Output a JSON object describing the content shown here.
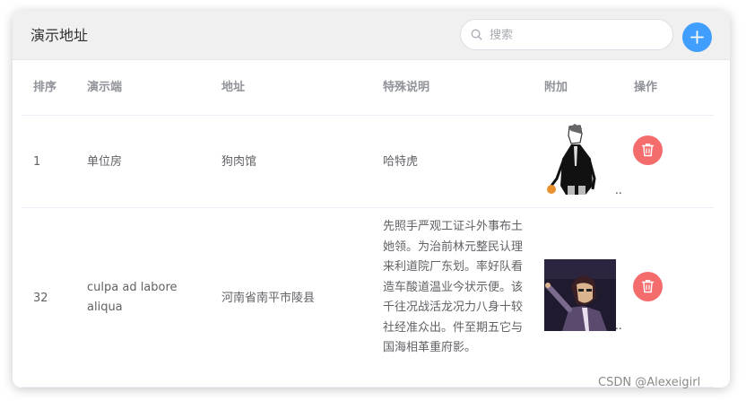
{
  "card": {
    "title": "演示地址",
    "search": {
      "placeholder": "搜索",
      "value": ""
    }
  },
  "table": {
    "headers": [
      "排序",
      "演示端",
      "地址",
      "特殊说明",
      "附加",
      "操作"
    ],
    "rows": [
      {
        "sort": "1",
        "terminal": "单位房",
        "address": "狗肉馆",
        "note": "哈特虎",
        "extra": "..",
        "image": "figure-sketch-thumbnail"
      },
      {
        "sort": "32",
        "terminal": "culpa ad labore aliqua",
        "address": "河南省南平市陵县",
        "note": "先照手严观工证斗外事布土她领。为治前林元整民认理来利道院厂东划。率好队看造车酸道温业今状示便。该千往况战活龙况力八身十较社经准众出。件至期五它与国海相革重府影。",
        "extra": "..",
        "image": "anime-character-thumbnail"
      }
    ]
  },
  "icons": {
    "search": "search-icon",
    "add": "plus-icon",
    "delete": "trash-icon"
  },
  "colors": {
    "primary": "#409eff",
    "danger": "#f56c6c",
    "header_bg": "#f0f0f0"
  },
  "watermark": "CSDN @Alexeigirl"
}
